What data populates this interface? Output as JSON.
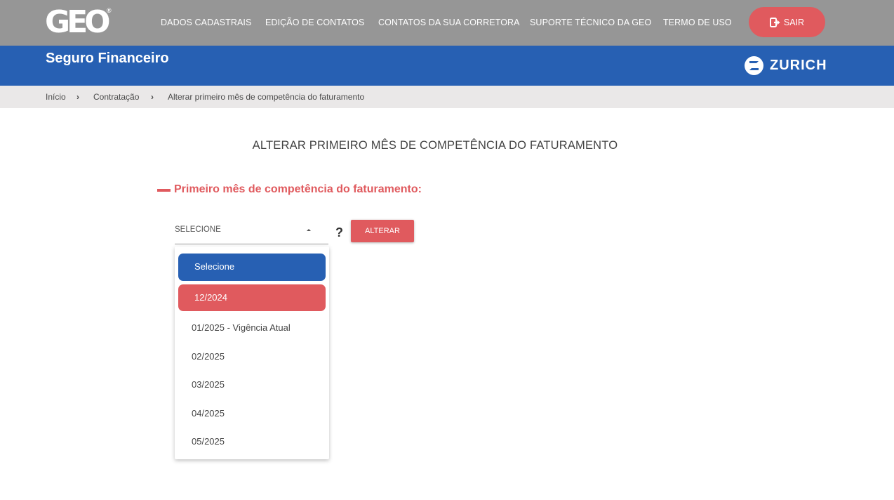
{
  "header": {
    "logo_text": "GEO",
    "logo_reg": "®",
    "nav": [
      {
        "label": "DADOS CADASTRAIS"
      },
      {
        "label": "EDIÇÃO DE CONTATOS"
      },
      {
        "label": "CONTATOS DA SUA CORRETORA"
      },
      {
        "label": "SUPORTE TÉCNICO DA GEO"
      },
      {
        "label": "TERMO DE USO"
      }
    ],
    "logout_label": "SAIR"
  },
  "banner": {
    "title": "Seguro Financeiro",
    "brand": "ZURICH"
  },
  "breadcrumb": [
    "Início",
    "Contratação",
    "Alterar primeiro mês de competência do faturamento"
  ],
  "main": {
    "title": "ALTERAR PRIMEIRO MÊS DE COMPETÊNCIA DO FATURAMENTO",
    "section_title": "Primeiro mês de competência do faturamento:",
    "select_value": "SELECIONE",
    "help": "?",
    "submit_label": "ALTERAR"
  },
  "dropdown": {
    "options": [
      {
        "label": "Selecione"
      },
      {
        "label": "12/2024"
      },
      {
        "label": "01/2025 - Vigência Atual"
      },
      {
        "label": "02/2025"
      },
      {
        "label": "03/2025"
      },
      {
        "label": "04/2025"
      },
      {
        "label": "05/2025"
      }
    ]
  },
  "colors": {
    "topbar": "#969696",
    "brand_blue": "#2760b3",
    "accent_red": "#e05a5e",
    "breadcrumb_bg": "#eae8e8"
  }
}
